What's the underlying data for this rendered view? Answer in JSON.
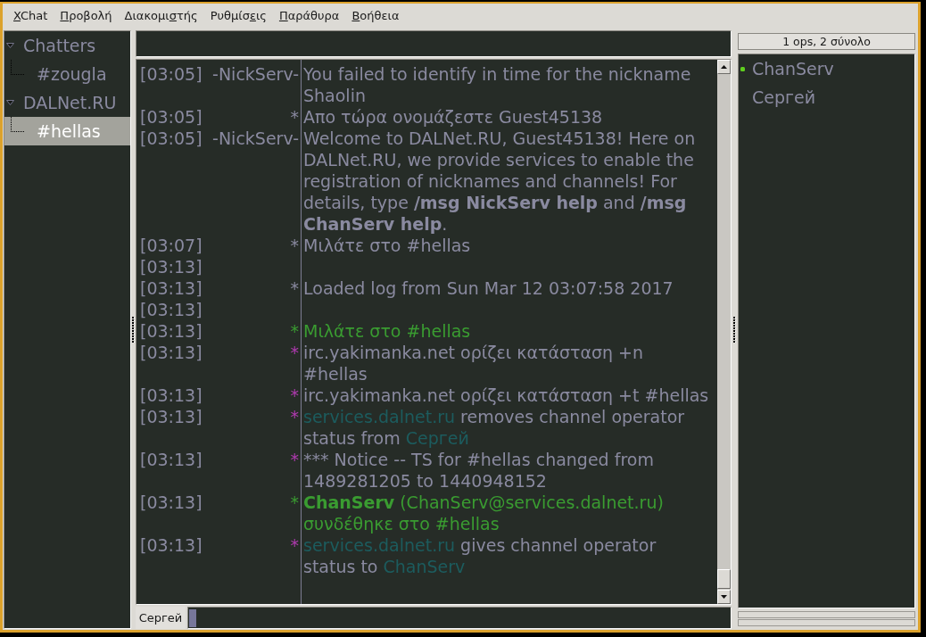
{
  "menu_bar": [
    {
      "access_key": "X",
      "text_after": "Chat"
    },
    {
      "access_key": "Π",
      "text_after": "ροβολή"
    },
    {
      "text_before": "Διακομι",
      "access_key": "σ",
      "text_after": "τής"
    },
    {
      "text_before": "Ρυθμίσ",
      "access_key": "ε",
      "text_after": "ις"
    },
    {
      "access_key": "Π",
      "text_after": "αράθυρα"
    },
    {
      "access_key": "Β",
      "text_after": "οήθεια"
    }
  ],
  "channel_tree": [
    {
      "label": "Chatters",
      "expanded": true,
      "selected": false,
      "children": [
        {
          "label": "#zougla",
          "selected": false
        }
      ]
    },
    {
      "label": "DALNet.RU",
      "expanded": true,
      "selected": false,
      "children": [
        {
          "label": "#hellas",
          "selected": true
        }
      ]
    }
  ],
  "chat": {
    "lines": [
      {
        "time": "[03:05]",
        "nick": {
          "text": "-NickServ-",
          "color": "#8a8aa0"
        },
        "message": [
          {
            "text": "You failed to identify in time for the nickname Shaolin",
            "color": "#8a8aa0"
          }
        ]
      },
      {
        "time": "[03:05]",
        "nick": {
          "text": "*",
          "color": "#8a8aa0"
        },
        "message": [
          {
            "text": "Απο τώρα ονομάζεστε Guest45138",
            "color": "#8a8aa0"
          }
        ]
      },
      {
        "time": "[03:05]",
        "nick": {
          "text": "-NickServ-",
          "color": "#8a8aa0"
        },
        "message": [
          {
            "text": "Welcome to DALNet.RU, Guest45138! Here on DALNet.RU, we provide services to enable the registration of nicknames and channels! For details, type **/msg NickServ help** and **/msg ChanServ help**.",
            "color": "#8a8aa0"
          }
        ]
      },
      {
        "time": "[03:07]",
        "nick": {
          "text": "*",
          "color": "#8a8aa0"
        },
        "message": [
          {
            "text": "Μιλάτε στο #hellas",
            "color": "#8a8aa0"
          }
        ]
      },
      {
        "time": "[03:13]"
      },
      {
        "time": "[03:13]",
        "nick": {
          "text": "*",
          "color": "#8a8aa0"
        },
        "message": [
          {
            "text": "Loaded log from Sun Mar 12 03:07:58 2017",
            "color": "#8a8aa0"
          }
        ]
      },
      {
        "time": "[03:13]"
      },
      {
        "time": "[03:13]",
        "nick": {
          "text": "*",
          "color": "#3a9c31"
        },
        "message": [
          {
            "text": "Μιλάτε στο #hellas",
            "color": "#3a9c31"
          }
        ]
      },
      {
        "time": "[03:13]",
        "nick": {
          "text": "*",
          "color": "#b03ab0"
        },
        "message": [
          {
            "text": "irc.yakimanka.net ορίζει κατάσταση +n #hellas",
            "color": "#8a8aa0"
          }
        ]
      },
      {
        "time": "[03:13]",
        "nick": {
          "text": "*",
          "color": "#b03ab0"
        },
        "message": [
          {
            "text": "irc.yakimanka.net ορίζει κατάσταση +t #hellas",
            "color": "#8a8aa0"
          }
        ]
      },
      {
        "time": "[03:13]",
        "nick": {
          "text": "*",
          "color": "#b03ab0"
        },
        "message": [
          {
            "text": "services.dalnet.ru",
            "color": "#1c5c5e"
          },
          {
            "text": " removes channel operator status from ",
            "color": "#8a8aa0"
          },
          {
            "text": "Сергей",
            "color": "#1c5c5e"
          }
        ]
      },
      {
        "time": "[03:13]",
        "nick": {
          "text": "*",
          "color": "#b03ab0"
        },
        "message": [
          {
            "text": "*** Notice -- TS for #hellas changed from 1489281205 to 1440948152",
            "color": "#8a8aa0"
          }
        ]
      },
      {
        "time": "[03:13]",
        "nick": {
          "text": "*",
          "color": "#3a9c31"
        },
        "message": [
          {
            "text": "**ChanServ** (ChanServ@services.dalnet.ru) συνδέθηκε στο #hellas",
            "color": "#3a9c31"
          }
        ]
      },
      {
        "time": "[03:13]",
        "nick": {
          "text": "*",
          "color": "#b03ab0"
        },
        "message": [
          {
            "text": "services.dalnet.ru",
            "color": "#1c5c5e"
          },
          {
            "text": " gives channel operator status to ",
            "color": "#8a8aa0"
          },
          {
            "text": "ChanServ",
            "color": "#1c5c5e"
          }
        ]
      }
    ]
  },
  "input_bar": {
    "nick_button": "Сергей"
  },
  "user_list": {
    "header": "1 ops, 2 σύνολο",
    "users": [
      {
        "name": "ChanServ",
        "op": true
      },
      {
        "name": "Сергей",
        "op": false
      }
    ]
  }
}
